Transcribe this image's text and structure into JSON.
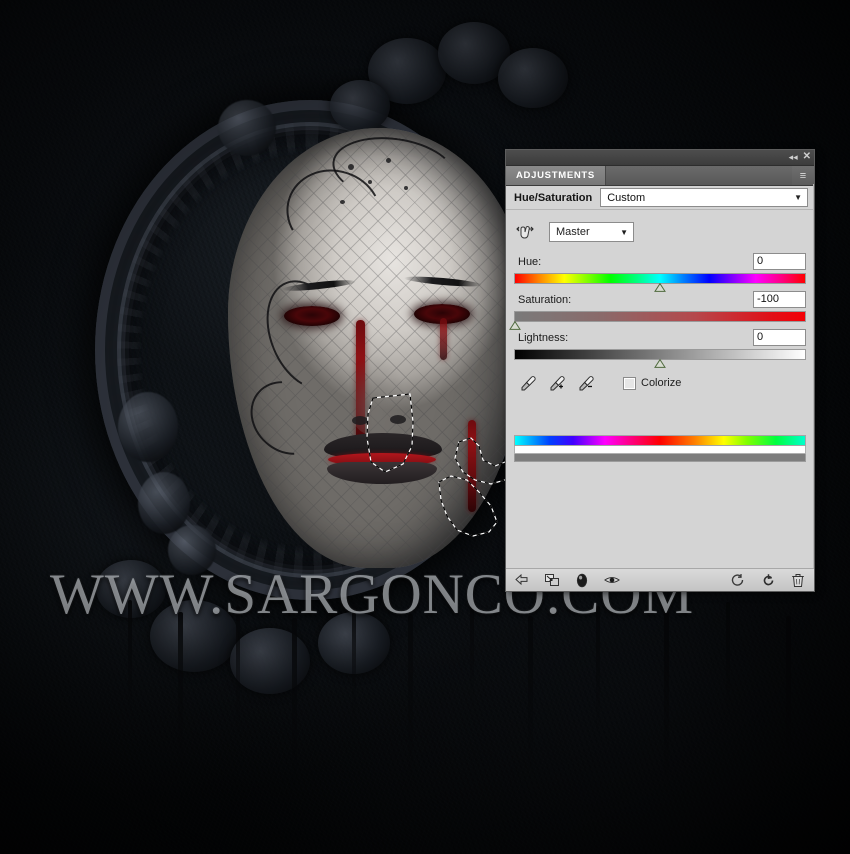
{
  "artwork": {
    "watermark_text": "WWW.SARGONCO.COM",
    "description": "Dark gothic portrait of a pale woman with lace veil, bleeding eyes and ornate black mirror frame",
    "selection": "marching-ants selection around mouth and cheek"
  },
  "panel": {
    "window_controls": {
      "collapse_label": "◂◂",
      "close_label": "✕"
    },
    "tabs": [
      {
        "label": "ADJUSTMENTS",
        "active": true
      }
    ],
    "menu_icon_label": "≡",
    "adjustment": {
      "title": "Hue/Saturation",
      "preset_value": "Custom",
      "preset_arrow": "▼",
      "channel_value": "Master",
      "channel_arrow": "▼",
      "scrub_icon_name": "targeted-adjustment-hand-icon"
    },
    "sliders": [
      {
        "label": "Hue:",
        "value": "0",
        "position_pct": 50,
        "track": "hue"
      },
      {
        "label": "Saturation:",
        "value": "-100",
        "position_pct": 0,
        "track": "sat"
      },
      {
        "label": "Lightness:",
        "value": "0",
        "position_pct": 50,
        "track": "light"
      }
    ],
    "eyedroppers": [
      {
        "name": "eyedropper-sample"
      },
      {
        "name": "eyedropper-add"
      },
      {
        "name": "eyedropper-subtract"
      }
    ],
    "colorize": {
      "label": "Colorize",
      "checked": false
    },
    "footer_icons": [
      {
        "name": "clip-to-layer-icon",
        "glyph": "↵"
      },
      {
        "name": "previous-state-icon",
        "glyph": "⬌"
      },
      {
        "name": "toggle-layer-mask-icon",
        "glyph": "●"
      },
      {
        "name": "toggle-visibility-icon",
        "glyph": "◉"
      },
      {
        "name": "return-to-list-icon",
        "glyph": "↺"
      },
      {
        "name": "reset-icon",
        "glyph": "↻"
      },
      {
        "name": "delete-layer-icon",
        "glyph": "Ὕ1"
      }
    ]
  },
  "colors": {
    "panel_bg": "#d4d4d4",
    "tab_bg": "#6e6e6e",
    "titlebar_bg": "#3c3c3c",
    "field_bg": "#ffffff",
    "text": "#1d1d1d"
  }
}
